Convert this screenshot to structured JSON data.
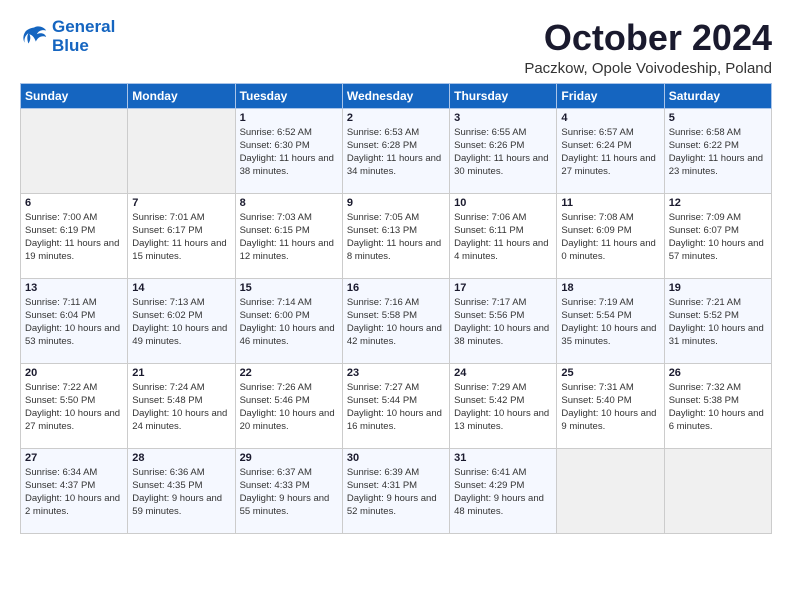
{
  "logo": {
    "line1": "General",
    "line2": "Blue"
  },
  "title": "October 2024",
  "location": "Paczkow, Opole Voivodeship, Poland",
  "weekdays": [
    "Sunday",
    "Monday",
    "Tuesday",
    "Wednesday",
    "Thursday",
    "Friday",
    "Saturday"
  ],
  "weeks": [
    [
      {
        "day": "",
        "info": ""
      },
      {
        "day": "",
        "info": ""
      },
      {
        "day": "1",
        "info": "Sunrise: 6:52 AM\nSunset: 6:30 PM\nDaylight: 11 hours and 38 minutes."
      },
      {
        "day": "2",
        "info": "Sunrise: 6:53 AM\nSunset: 6:28 PM\nDaylight: 11 hours and 34 minutes."
      },
      {
        "day": "3",
        "info": "Sunrise: 6:55 AM\nSunset: 6:26 PM\nDaylight: 11 hours and 30 minutes."
      },
      {
        "day": "4",
        "info": "Sunrise: 6:57 AM\nSunset: 6:24 PM\nDaylight: 11 hours and 27 minutes."
      },
      {
        "day": "5",
        "info": "Sunrise: 6:58 AM\nSunset: 6:22 PM\nDaylight: 11 hours and 23 minutes."
      }
    ],
    [
      {
        "day": "6",
        "info": "Sunrise: 7:00 AM\nSunset: 6:19 PM\nDaylight: 11 hours and 19 minutes."
      },
      {
        "day": "7",
        "info": "Sunrise: 7:01 AM\nSunset: 6:17 PM\nDaylight: 11 hours and 15 minutes."
      },
      {
        "day": "8",
        "info": "Sunrise: 7:03 AM\nSunset: 6:15 PM\nDaylight: 11 hours and 12 minutes."
      },
      {
        "day": "9",
        "info": "Sunrise: 7:05 AM\nSunset: 6:13 PM\nDaylight: 11 hours and 8 minutes."
      },
      {
        "day": "10",
        "info": "Sunrise: 7:06 AM\nSunset: 6:11 PM\nDaylight: 11 hours and 4 minutes."
      },
      {
        "day": "11",
        "info": "Sunrise: 7:08 AM\nSunset: 6:09 PM\nDaylight: 11 hours and 0 minutes."
      },
      {
        "day": "12",
        "info": "Sunrise: 7:09 AM\nSunset: 6:07 PM\nDaylight: 10 hours and 57 minutes."
      }
    ],
    [
      {
        "day": "13",
        "info": "Sunrise: 7:11 AM\nSunset: 6:04 PM\nDaylight: 10 hours and 53 minutes."
      },
      {
        "day": "14",
        "info": "Sunrise: 7:13 AM\nSunset: 6:02 PM\nDaylight: 10 hours and 49 minutes."
      },
      {
        "day": "15",
        "info": "Sunrise: 7:14 AM\nSunset: 6:00 PM\nDaylight: 10 hours and 46 minutes."
      },
      {
        "day": "16",
        "info": "Sunrise: 7:16 AM\nSunset: 5:58 PM\nDaylight: 10 hours and 42 minutes."
      },
      {
        "day": "17",
        "info": "Sunrise: 7:17 AM\nSunset: 5:56 PM\nDaylight: 10 hours and 38 minutes."
      },
      {
        "day": "18",
        "info": "Sunrise: 7:19 AM\nSunset: 5:54 PM\nDaylight: 10 hours and 35 minutes."
      },
      {
        "day": "19",
        "info": "Sunrise: 7:21 AM\nSunset: 5:52 PM\nDaylight: 10 hours and 31 minutes."
      }
    ],
    [
      {
        "day": "20",
        "info": "Sunrise: 7:22 AM\nSunset: 5:50 PM\nDaylight: 10 hours and 27 minutes."
      },
      {
        "day": "21",
        "info": "Sunrise: 7:24 AM\nSunset: 5:48 PM\nDaylight: 10 hours and 24 minutes."
      },
      {
        "day": "22",
        "info": "Sunrise: 7:26 AM\nSunset: 5:46 PM\nDaylight: 10 hours and 20 minutes."
      },
      {
        "day": "23",
        "info": "Sunrise: 7:27 AM\nSunset: 5:44 PM\nDaylight: 10 hours and 16 minutes."
      },
      {
        "day": "24",
        "info": "Sunrise: 7:29 AM\nSunset: 5:42 PM\nDaylight: 10 hours and 13 minutes."
      },
      {
        "day": "25",
        "info": "Sunrise: 7:31 AM\nSunset: 5:40 PM\nDaylight: 10 hours and 9 minutes."
      },
      {
        "day": "26",
        "info": "Sunrise: 7:32 AM\nSunset: 5:38 PM\nDaylight: 10 hours and 6 minutes."
      }
    ],
    [
      {
        "day": "27",
        "info": "Sunrise: 6:34 AM\nSunset: 4:37 PM\nDaylight: 10 hours and 2 minutes."
      },
      {
        "day": "28",
        "info": "Sunrise: 6:36 AM\nSunset: 4:35 PM\nDaylight: 9 hours and 59 minutes."
      },
      {
        "day": "29",
        "info": "Sunrise: 6:37 AM\nSunset: 4:33 PM\nDaylight: 9 hours and 55 minutes."
      },
      {
        "day": "30",
        "info": "Sunrise: 6:39 AM\nSunset: 4:31 PM\nDaylight: 9 hours and 52 minutes."
      },
      {
        "day": "31",
        "info": "Sunrise: 6:41 AM\nSunset: 4:29 PM\nDaylight: 9 hours and 48 minutes."
      },
      {
        "day": "",
        "info": ""
      },
      {
        "day": "",
        "info": ""
      }
    ]
  ]
}
